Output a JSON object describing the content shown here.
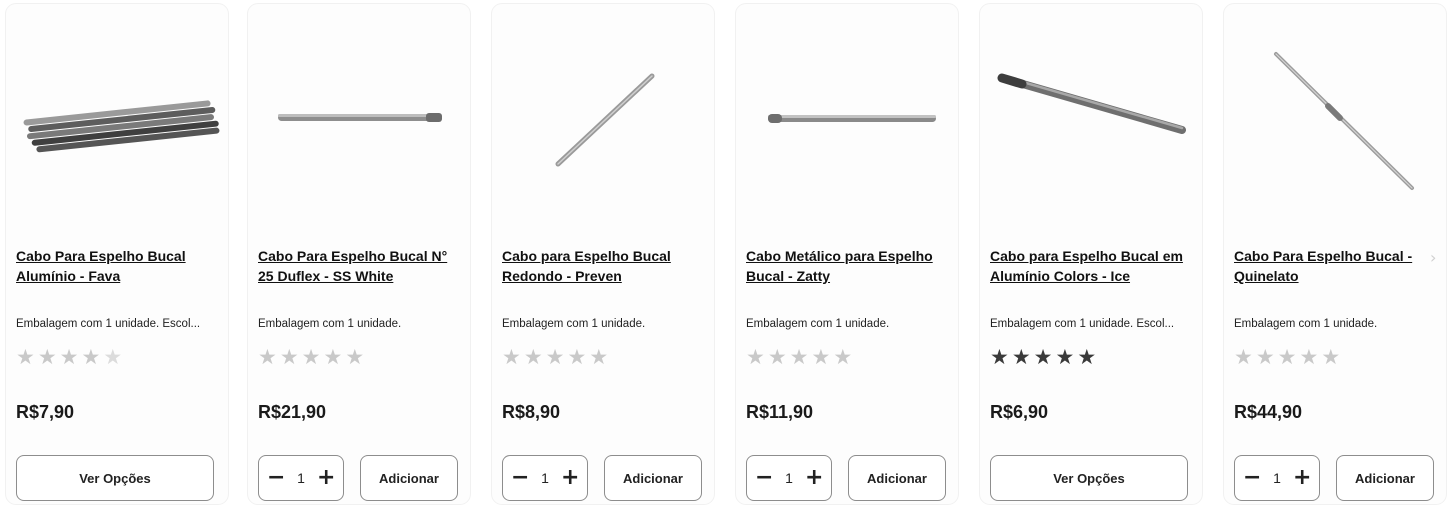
{
  "products": [
    {
      "title": "Cabo Para Espelho Bucal Alumínio - Fava",
      "description": "Embalagem com 1 unidade. Escol...",
      "stars": 5,
      "star_style": "light",
      "price": "R$7,90",
      "action": "options",
      "button_label": "Ver Opções",
      "image_icon": "handle-bundle-icon"
    },
    {
      "title": "Cabo Para Espelho Bucal N° 25 Duflex - SS White",
      "description": "Embalagem com 1 unidade.",
      "stars": 5,
      "star_style": "light",
      "price": "R$21,90",
      "action": "add",
      "quantity": "1",
      "button_label": "Adicionar",
      "image_icon": "handle-horizontal-icon"
    },
    {
      "title": "Cabo para Espelho Bucal Redondo - Preven",
      "description": "Embalagem com 1 unidade.",
      "stars": 5,
      "star_style": "light",
      "price": "R$8,90",
      "action": "add",
      "quantity": "1",
      "button_label": "Adicionar",
      "image_icon": "handle-diagonal-icon"
    },
    {
      "title": "Cabo Metálico para Espelho Bucal - Zatty",
      "description": "Embalagem com 1 unidade.",
      "stars": 5,
      "star_style": "light",
      "price": "R$11,90",
      "action": "add",
      "quantity": "1",
      "button_label": "Adicionar",
      "image_icon": "handle-horizontal-icon"
    },
    {
      "title": "Cabo para Espelho Bucal em Alumínio Colors - Ice",
      "description": "Embalagem com 1 unidade. Escol...",
      "stars": 5,
      "star_style": "dark",
      "price": "R$6,90",
      "action": "options",
      "button_label": "Ver Opções",
      "image_icon": "handle-angled-icon"
    },
    {
      "title": "Cabo Para Espelho Bucal - Quinelato",
      "description": "Embalagem com 1 unidade.",
      "stars": 5,
      "star_style": "light",
      "price": "R$44,90",
      "action": "add",
      "quantity": "1",
      "button_label": "Adicionar",
      "image_icon": "handle-steep-icon"
    }
  ],
  "stepper": {
    "minus": "−",
    "plus": "+"
  },
  "carousel": {
    "next_icon": "chevron-right-icon",
    "next_glyph": "›"
  }
}
